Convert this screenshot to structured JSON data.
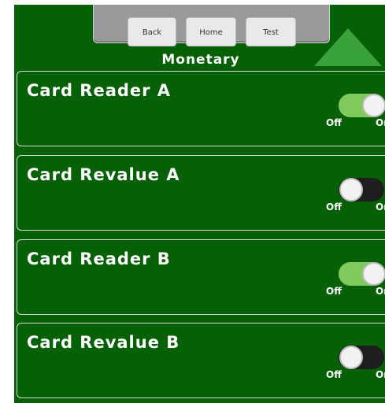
{
  "nav": {
    "back_label": "Back",
    "home_label": "Home",
    "test_label": "Test"
  },
  "page_title": "Monetary",
  "toggle_labels": {
    "off": "Off",
    "on": "On"
  },
  "cards": [
    {
      "title": "Card Reader A",
      "state": "on"
    },
    {
      "title": "Card Revalue A",
      "state": "off"
    },
    {
      "title": "Card Reader B",
      "state": "on"
    },
    {
      "title": "Card Revalue B",
      "state": "off"
    }
  ],
  "colors": {
    "screen_background": "#066006",
    "toggle_on": "#7fca5a",
    "toggle_off": "#1e1e1e",
    "arrow": "#3aa23a"
  },
  "icons": {
    "scroll_up": "up-arrow-icon"
  }
}
